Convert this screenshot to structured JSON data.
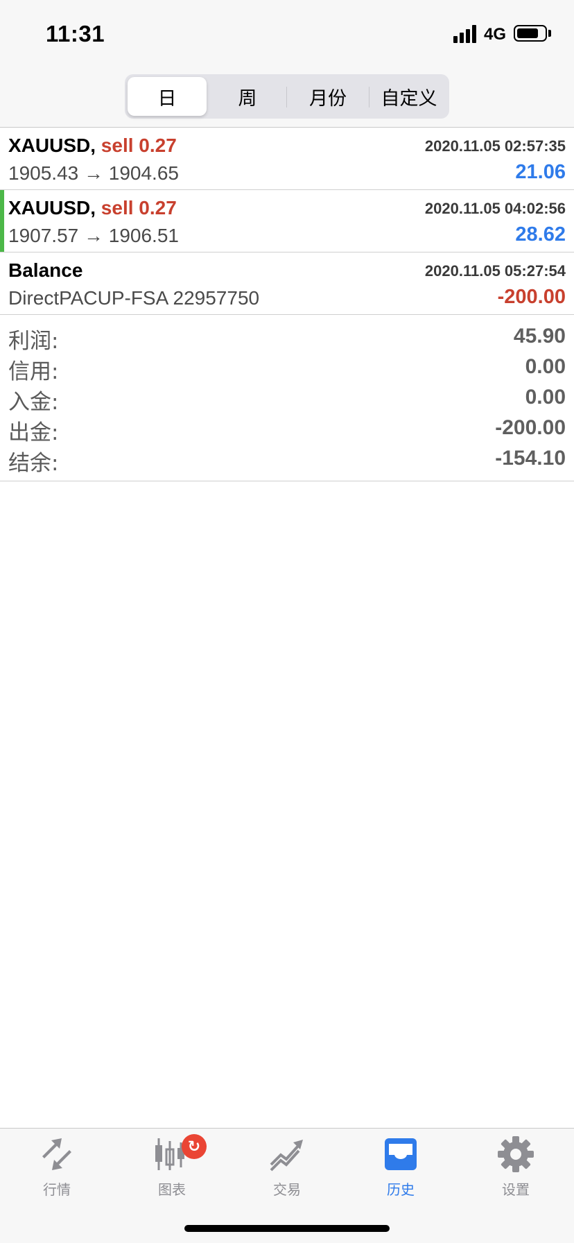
{
  "status_bar": {
    "time": "11:31",
    "network": "4G"
  },
  "periods": {
    "items": [
      "日",
      "周",
      "月份",
      "自定义"
    ],
    "active": "日"
  },
  "deals": [
    {
      "symbol": "XAUUSD,",
      "side": "sell 0.27",
      "time": "2020.11.05 02:57:35",
      "detail": "1905.43 → 1904.65",
      "amount": "21.06",
      "amount_color": "#2f7bea"
    },
    {
      "symbol": "XAUUSD,",
      "side": "sell 0.27",
      "time": "2020.11.05 04:02:56",
      "detail": "1907.57 → 1906.51",
      "amount": "28.62",
      "amount_color": "#2f7bea"
    },
    {
      "symbol": "Balance",
      "side": "",
      "time": "2020.11.05 05:27:54",
      "detail": "DirectPACUP-FSA 22957750",
      "amount": "-200.00",
      "amount_color": "#c8402e"
    }
  ],
  "summary": [
    {
      "label": "利润:",
      "value": "45.90"
    },
    {
      "label": "信用:",
      "value": "0.00"
    },
    {
      "label": "入金:",
      "value": "0.00"
    },
    {
      "label": "出金:",
      "value": "-200.00"
    },
    {
      "label": "结余:",
      "value": "-154.10"
    }
  ],
  "colors": {
    "sell": "#c8402e",
    "profit": "#2f7bea",
    "loss": "#c8402e",
    "active_tab": "#2f7bea",
    "marker": "#4cb848"
  },
  "tabs": [
    {
      "label": "行情",
      "icon": "quotes-arrows-icon"
    },
    {
      "label": "图表",
      "icon": "candlestick-chart-icon",
      "badge_icon": "refresh-icon"
    },
    {
      "label": "交易",
      "icon": "trade-trend-icon"
    },
    {
      "label": "历史",
      "icon": "history-inbox-icon",
      "active": true
    },
    {
      "label": "设置",
      "icon": "settings-gear-icon"
    }
  ]
}
